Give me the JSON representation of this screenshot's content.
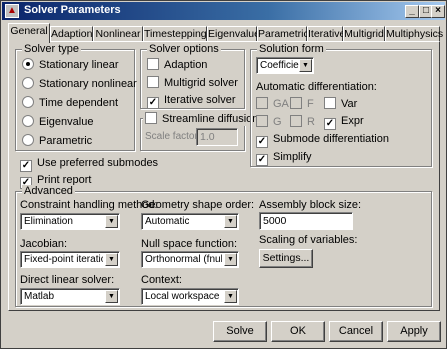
{
  "window": {
    "title": "Solver Parameters",
    "min": "_",
    "max": "□",
    "close": "×",
    "app_icon": "matlab-icon"
  },
  "tabs": [
    "General",
    "Adaption",
    "Nonlinear",
    "Timestepping",
    "Eigenvalue",
    "Parametric",
    "Iterative",
    "Multigrid",
    "Multiphysics"
  ],
  "solver_type": {
    "title": "Solver type",
    "options": [
      "Stationary linear",
      "Stationary nonlinear",
      "Time dependent",
      "Eigenvalue",
      "Parametric"
    ],
    "selected": "Stationary linear"
  },
  "solver_options": {
    "title": "Solver options",
    "adaption": "Adaption",
    "multigrid": "Multigrid solver",
    "iterative": "Iterative solver"
  },
  "streamline": {
    "title": "Streamline diffusion",
    "scale_label": "Scale factor:",
    "scale_value": "1.0"
  },
  "solution_form": {
    "title": "Solution form",
    "value": "Coefficient",
    "autodiff_label": "Automatic differentiation:",
    "ga": "GA",
    "f": "F",
    "var": "Var",
    "g": "G",
    "r": "R",
    "expr": "Expr",
    "submode": "Submode differentiation",
    "simplify": "Simplify"
  },
  "preferred_submodes": "Use preferred submodes",
  "print_report": "Print report",
  "advanced": {
    "title": "Advanced",
    "constraint_label": "Constraint handling method:",
    "constraint_value": "Elimination",
    "geometry_label": "Geometry shape order:",
    "geometry_value": "Automatic",
    "assembly_label": "Assembly block size:",
    "assembly_value": "5000",
    "jacobian_label": "Jacobian:",
    "jacobian_value": "Fixed-point iteration",
    "nullspace_label": "Null space function:",
    "nullspace_value": "Orthonormal (fnullorth)",
    "scaling_label": "Scaling of variables:",
    "settings_button": "Settings...",
    "direct_label": "Direct linear solver:",
    "direct_value": "Matlab",
    "context_label": "Context:",
    "context_value": "Local workspace"
  },
  "buttons": {
    "solve": "Solve",
    "ok": "OK",
    "cancel": "Cancel",
    "apply": "Apply"
  }
}
